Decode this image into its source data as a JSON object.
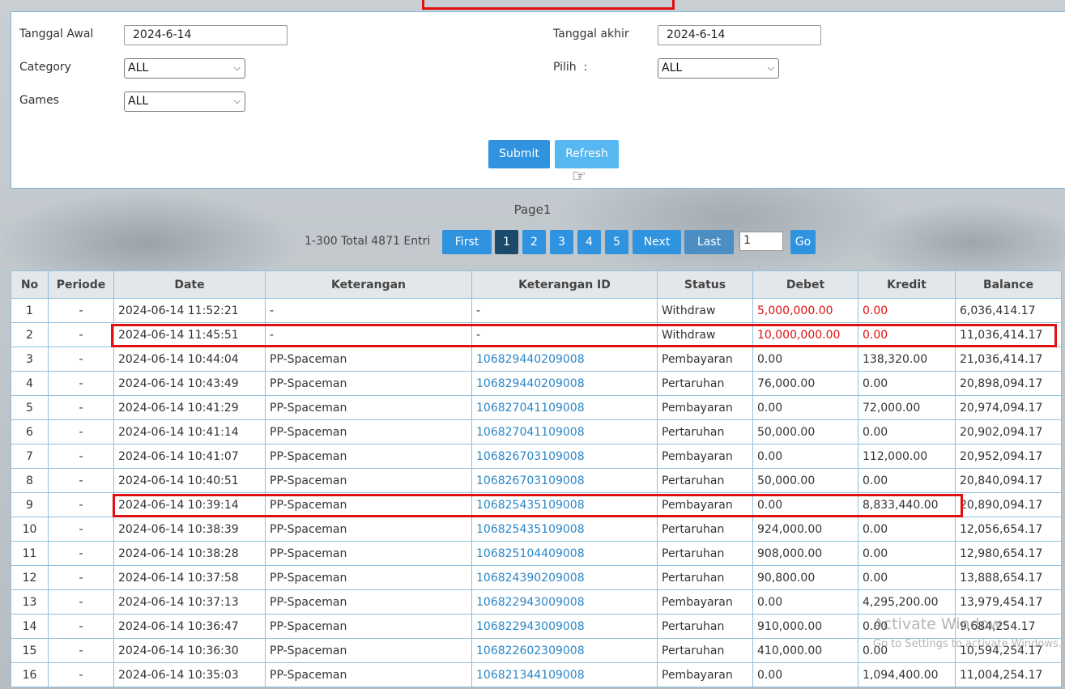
{
  "filter": {
    "tanggal_awal_label": "Tanggal Awal",
    "tanggal_awal_value": "2024-6-14",
    "tanggal_akhir_label": "Tanggal akhir",
    "tanggal_akhir_value": "2024-6-14",
    "category_label": "Category",
    "category_value": "ALL",
    "pilih_label": "Pilih  :",
    "pilih_value": "ALL",
    "games_label": "Games",
    "games_value": "ALL",
    "submit_label": "Submit",
    "refresh_label": "Refresh"
  },
  "pagination": {
    "title": "Page1",
    "summary": "1-300 Total 4871 Entri",
    "first": "First",
    "pages": [
      "1",
      "2",
      "3",
      "4",
      "5"
    ],
    "next": "Next",
    "last": "Last",
    "page_input": "1",
    "go": "Go"
  },
  "table": {
    "headers": [
      "No",
      "Periode",
      "Date",
      "Keterangan",
      "Keterangan ID",
      "Status",
      "Debet",
      "Kredit",
      "Balance"
    ],
    "rows": [
      [
        "1",
        "-",
        "2024-06-14 11:52:21",
        "-",
        "-",
        "Withdraw",
        "5,000,000.00",
        "0.00",
        "6,036,414.17"
      ],
      [
        "2",
        "-",
        "2024-06-14 11:45:51",
        "-",
        "-",
        "Withdraw",
        "10,000,000.00",
        "0.00",
        "11,036,414.17"
      ],
      [
        "3",
        "-",
        "2024-06-14 10:44:04",
        "PP-Spaceman",
        "106829440209008",
        "Pembayaran",
        "0.00",
        "138,320.00",
        "21,036,414.17"
      ],
      [
        "4",
        "-",
        "2024-06-14 10:43:49",
        "PP-Spaceman",
        "106829440209008",
        "Pertaruhan",
        "76,000.00",
        "0.00",
        "20,898,094.17"
      ],
      [
        "5",
        "-",
        "2024-06-14 10:41:29",
        "PP-Spaceman",
        "106827041109008",
        "Pembayaran",
        "0.00",
        "72,000.00",
        "20,974,094.17"
      ],
      [
        "6",
        "-",
        "2024-06-14 10:41:14",
        "PP-Spaceman",
        "106827041109008",
        "Pertaruhan",
        "50,000.00",
        "0.00",
        "20,902,094.17"
      ],
      [
        "7",
        "-",
        "2024-06-14 10:41:07",
        "PP-Spaceman",
        "106826703109008",
        "Pembayaran",
        "0.00",
        "112,000.00",
        "20,952,094.17"
      ],
      [
        "8",
        "-",
        "2024-06-14 10:40:51",
        "PP-Spaceman",
        "106826703109008",
        "Pertaruhan",
        "50,000.00",
        "0.00",
        "20,840,094.17"
      ],
      [
        "9",
        "-",
        "2024-06-14 10:39:14",
        "PP-Spaceman",
        "106825435109008",
        "Pembayaran",
        "0.00",
        "8,833,440.00",
        "20,890,094.17"
      ],
      [
        "10",
        "-",
        "2024-06-14 10:38:39",
        "PP-Spaceman",
        "106825435109008",
        "Pertaruhan",
        "924,000.00",
        "0.00",
        "12,056,654.17"
      ],
      [
        "11",
        "-",
        "2024-06-14 10:38:28",
        "PP-Spaceman",
        "106825104409008",
        "Pertaruhan",
        "908,000.00",
        "0.00",
        "12,980,654.17"
      ],
      [
        "12",
        "-",
        "2024-06-14 10:37:58",
        "PP-Spaceman",
        "106824390209008",
        "Pertaruhan",
        "90,800.00",
        "0.00",
        "13,888,654.17"
      ],
      [
        "13",
        "-",
        "2024-06-14 10:37:13",
        "PP-Spaceman",
        "106822943009008",
        "Pembayaran",
        "0.00",
        "4,295,200.00",
        "13,979,454.17"
      ],
      [
        "14",
        "-",
        "2024-06-14 10:36:47",
        "PP-Spaceman",
        "106822943009008",
        "Pertaruhan",
        "910,000.00",
        "0.00",
        "9,684,254.17"
      ],
      [
        "15",
        "-",
        "2024-06-14 10:36:30",
        "PP-Spaceman",
        "106822602309008",
        "Pertaruhan",
        "410,000.00",
        "0.00",
        "10,594,254.17"
      ],
      [
        "16",
        "-",
        "2024-06-14 10:35:03",
        "PP-Spaceman",
        "106821344109008",
        "Pembayaran",
        "0.00",
        "1,094,400.00",
        "11,004,254.17"
      ]
    ]
  },
  "watermark": {
    "line1": "Activate Windows",
    "line2": "Go to Settings to activate Windows."
  },
  "colors": {
    "accent": "#2f93e0",
    "highlight": "#e01010",
    "link": "#2a86c8"
  }
}
